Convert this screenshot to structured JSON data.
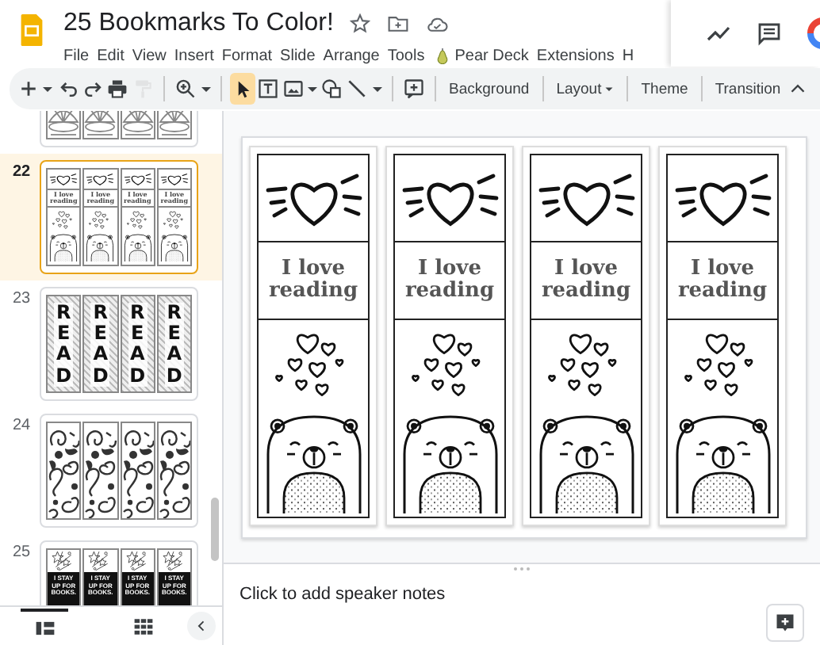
{
  "document": {
    "title": "25 Bookmarks To Color!"
  },
  "menu": [
    {
      "label": "File",
      "kind": "plain"
    },
    {
      "label": "Edit",
      "kind": "plain"
    },
    {
      "label": "View",
      "kind": "plain"
    },
    {
      "label": "Insert",
      "kind": "plain"
    },
    {
      "label": "Format",
      "kind": "plain"
    },
    {
      "label": "Slide",
      "kind": "plain"
    },
    {
      "label": "Arrange",
      "kind": "plain"
    },
    {
      "label": "Tools",
      "kind": "plain"
    },
    {
      "label": "Pear Deck",
      "kind": "addon"
    },
    {
      "label": "Extensions",
      "kind": "plain"
    },
    {
      "label": "H",
      "kind": "plain"
    }
  ],
  "toolbar": {
    "tools": [
      {
        "kind": "new",
        "selected": false,
        "disabled": false
      },
      {
        "kind": "caret",
        "selected": false,
        "disabled": false
      },
      {
        "kind": "undo",
        "selected": false,
        "disabled": false
      },
      {
        "kind": "redo",
        "selected": false,
        "disabled": false
      },
      {
        "kind": "print",
        "selected": false,
        "disabled": false
      },
      {
        "kind": "paint",
        "selected": false,
        "disabled": true
      },
      {
        "kind": "separator"
      },
      {
        "kind": "zoom",
        "selected": false,
        "disabled": false
      },
      {
        "kind": "caret",
        "selected": false,
        "disabled": false
      },
      {
        "kind": "separator"
      },
      {
        "kind": "select",
        "selected": true,
        "disabled": false
      },
      {
        "kind": "textbox",
        "selected": false,
        "disabled": false
      },
      {
        "kind": "image",
        "selected": false,
        "disabled": false
      },
      {
        "kind": "caret",
        "selected": false,
        "disabled": false
      },
      {
        "kind": "shapes",
        "selected": false,
        "disabled": false
      },
      {
        "kind": "line",
        "selected": false,
        "disabled": false
      },
      {
        "kind": "caret",
        "selected": false,
        "disabled": false
      },
      {
        "kind": "separator"
      },
      {
        "kind": "comment",
        "selected": false,
        "disabled": false
      },
      {
        "kind": "separator"
      }
    ],
    "buttons": [
      {
        "label": "Background",
        "kind": "plain"
      },
      {
        "label": "Layout",
        "kind": "dropdown"
      },
      {
        "label": "Theme",
        "kind": "plain"
      },
      {
        "label": "Transition",
        "kind": "plain"
      }
    ]
  },
  "filmstrip": {
    "slides": [
      {
        "kind": "shells",
        "selected": false
      },
      {
        "number": "22",
        "kind": "bears",
        "selected": true,
        "bookmarks": [
          "I love reading",
          "I love reading",
          "I love reading",
          "I love reading"
        ]
      },
      {
        "number": "23",
        "kind": "letters",
        "selected": false,
        "bookmarks": [
          "READ",
          "READ",
          "READ",
          "READ"
        ]
      },
      {
        "number": "24",
        "kind": "paisley",
        "selected": false
      },
      {
        "number": "25",
        "kind": "stars",
        "selected": false,
        "bookmarks": [
          "I STAY UP FOR BOOKS.",
          "I STAY UP FOR BOOKS.",
          "I STAY UP FOR BOOKS.",
          "I STAY UP FOR BOOKS."
        ]
      }
    ],
    "view_buttons": [
      {
        "kind": "list",
        "selected": true
      },
      {
        "kind": "grid",
        "selected": false
      }
    ]
  },
  "slide": {
    "bookmarks": [
      {
        "text": "I love reading"
      },
      {
        "text": "I love reading"
      },
      {
        "text": "I love reading"
      },
      {
        "text": "I love reading"
      }
    ]
  },
  "speaker_notes": {
    "placeholder": "Click to add speaker notes"
  }
}
